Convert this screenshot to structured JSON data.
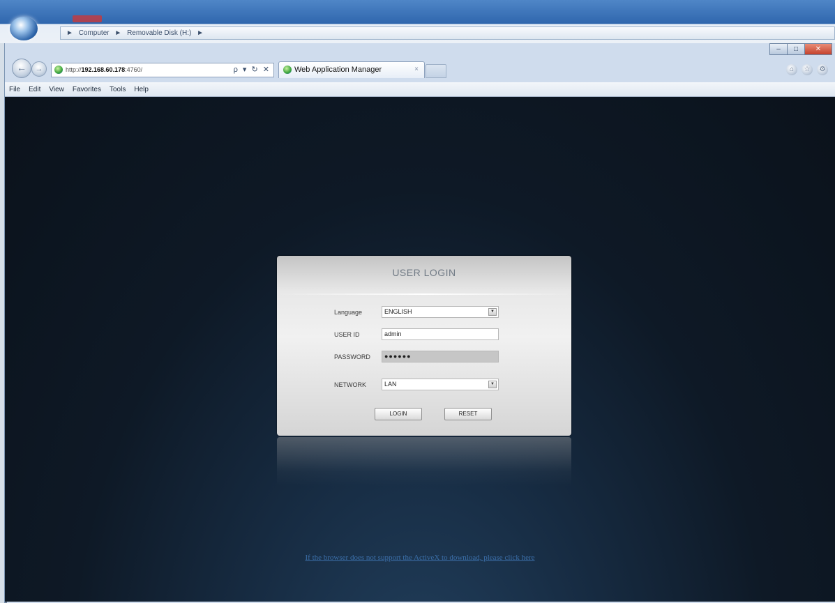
{
  "explorer": {
    "path": [
      "Computer",
      "Removable Disk (H:)"
    ],
    "separator": "►"
  },
  "browser": {
    "url_prefix": "http://",
    "url_host": "192.168.60.178",
    "url_rest": ":4760/",
    "address_tools": "ρ ▾ ↻ ✕",
    "tab_title": "Web Application Manager",
    "tab_close": "×",
    "menu": [
      "File",
      "Edit",
      "View",
      "Favorites",
      "Tools",
      "Help"
    ],
    "window_controls": {
      "minimize": "–",
      "maximize": "□",
      "close": "✕"
    },
    "toolbar_icons": [
      "home-icon",
      "star-icon",
      "gear-icon"
    ]
  },
  "login": {
    "title": "USER LOGIN",
    "language_label": "Language",
    "language_value": "ENGLISH",
    "userid_label": "USER ID",
    "userid_value": "admin",
    "password_label": "PASSWORD",
    "password_value": "●●●●●●",
    "network_label": "NETWORK",
    "network_value": "LAN",
    "login_button": "LOGIN",
    "reset_button": "RESET"
  },
  "plugin_link": "If the browser does not support the ActiveX to download, please click here",
  "colors": {
    "page_bg": "#0e1926",
    "card": "#e8e8e8",
    "link": "#3b6ea8"
  }
}
